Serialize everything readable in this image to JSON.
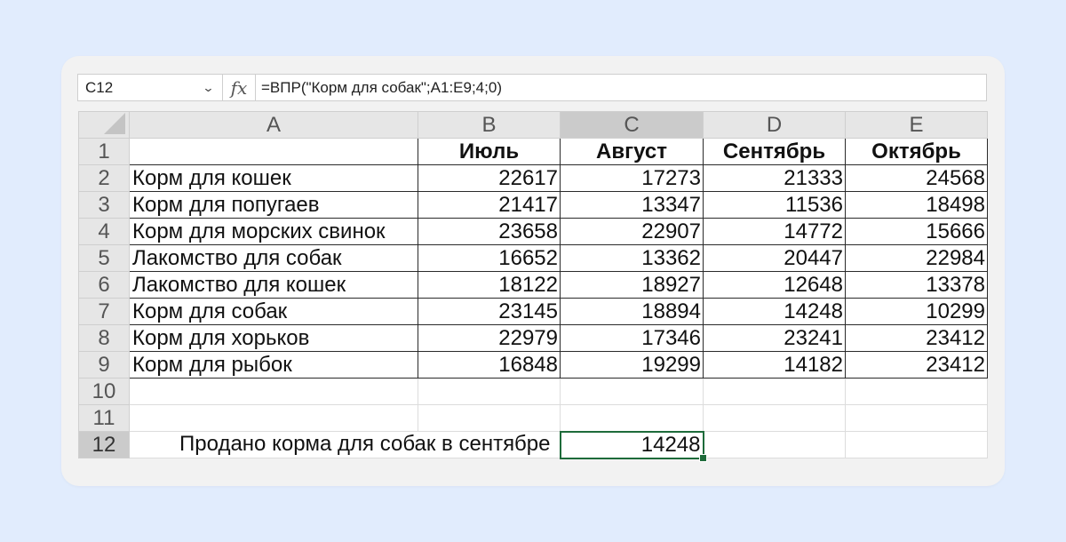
{
  "formula_bar": {
    "cell_ref": "C12",
    "fx_label": "fx",
    "formula": "=ВПР(\"Корм для собак\";A1:E9;4;0)"
  },
  "columns": [
    "A",
    "B",
    "C",
    "D",
    "E"
  ],
  "selected_column": "C",
  "row_numbers": [
    "1",
    "2",
    "3",
    "4",
    "5",
    "6",
    "7",
    "8",
    "9",
    "10",
    "11",
    "12"
  ],
  "table": {
    "headers": [
      "",
      "Июль",
      "Август",
      "Сентябрь",
      "Октябрь"
    ],
    "rows": [
      {
        "name": "Корм для кошек",
        "values": [
          "22617",
          "17273",
          "21333",
          "24568"
        ]
      },
      {
        "name": "Корм для попугаев",
        "values": [
          "21417",
          "13347",
          "11536",
          "18498"
        ]
      },
      {
        "name": "Корм для морских свинок",
        "values": [
          "23658",
          "22907",
          "14772",
          "15666"
        ]
      },
      {
        "name": "Лакомство для собак",
        "values": [
          "16652",
          "13362",
          "20447",
          "22984"
        ]
      },
      {
        "name": "Лакомство для кошек",
        "values": [
          "18122",
          "18927",
          "12648",
          "13378"
        ]
      },
      {
        "name": "Корм для собак",
        "values": [
          "23145",
          "18894",
          "14248",
          "10299"
        ]
      },
      {
        "name": "Корм для хорьков",
        "values": [
          "22979",
          "17346",
          "23241",
          "23412"
        ]
      },
      {
        "name": "Корм для рыбок",
        "values": [
          "16848",
          "19299",
          "14182",
          "23412"
        ]
      }
    ]
  },
  "result_row": {
    "label": "Продано корма для собак в сентябре",
    "value": "14248"
  },
  "colors": {
    "page_bg": "#e1ecfd",
    "active_cell_border": "#1e6b3a",
    "header_bg": "#e6e6e6",
    "selected_header_bg": "#cbcbcb"
  }
}
